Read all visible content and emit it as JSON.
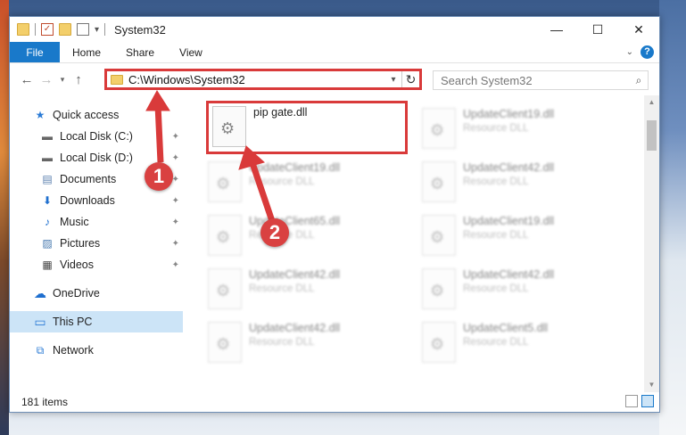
{
  "window": {
    "title": "System32",
    "minimize_glyph": "—",
    "maximize_glyph": "☐",
    "close_glyph": "✕"
  },
  "ribbon": {
    "tabs": [
      "File",
      "Home",
      "Share",
      "View"
    ],
    "help_glyph": "?",
    "expand_glyph": "⌄"
  },
  "nav": {
    "back_glyph": "←",
    "forward_glyph": "→",
    "recent_glyph": "▾",
    "up_glyph": "↑"
  },
  "address": {
    "path": "C:\\Windows\\System32",
    "dropdown_glyph": "▾",
    "refresh_glyph": "↻"
  },
  "search": {
    "placeholder": "Search System32",
    "icon_glyph": "⌕"
  },
  "sidebar": {
    "items": [
      {
        "label": "Quick access",
        "icon": "star-icon",
        "glyph": "★",
        "pinned": false
      },
      {
        "label": "Local Disk (C:)",
        "icon": "drive-icon",
        "glyph": "▬",
        "pinned": true
      },
      {
        "label": "Local Disk (D:)",
        "icon": "drive-icon",
        "glyph": "▬",
        "pinned": true
      },
      {
        "label": "Documents",
        "icon": "documents-icon",
        "glyph": "▤",
        "pinned": true
      },
      {
        "label": "Downloads",
        "icon": "download-icon",
        "glyph": "⬇",
        "pinned": true
      },
      {
        "label": "Music",
        "icon": "music-icon",
        "glyph": "♪",
        "pinned": true
      },
      {
        "label": "Pictures",
        "icon": "pictures-icon",
        "glyph": "▨",
        "pinned": true
      },
      {
        "label": "Videos",
        "icon": "videos-icon",
        "glyph": "▦",
        "pinned": true
      },
      {
        "label": "OneDrive",
        "icon": "cloud-icon",
        "glyph": "☁",
        "pinned": false
      },
      {
        "label": "This PC",
        "icon": "computer-icon",
        "glyph": "▭",
        "pinned": false
      },
      {
        "label": "Network",
        "icon": "network-icon",
        "glyph": "⧉",
        "pinned": false
      }
    ],
    "pin_glyph": "📌"
  },
  "files": [
    {
      "name": "pip gate.dll",
      "type": ""
    },
    {
      "name": "UpdateClient19.dll",
      "type": "Resource DLL"
    },
    {
      "name": "UpdateClient19.dll",
      "type": "Resource DLL"
    },
    {
      "name": "UpdateClient42.dll",
      "type": "Resource DLL"
    },
    {
      "name": "UpdateClient65.dll",
      "type": "Resource DLL"
    },
    {
      "name": "UpdateClient19.dll",
      "type": "Resource DLL"
    },
    {
      "name": "UpdateClient42.dll",
      "type": "Resource DLL"
    },
    {
      "name": "UpdateClient42.dll",
      "type": "Resource DLL"
    },
    {
      "name": "UpdateClient42.dll",
      "type": "Resource DLL"
    },
    {
      "name": "UpdateClient5.dll",
      "type": "Resource DLL"
    }
  ],
  "status": {
    "item_count": "181 items"
  },
  "annotations": {
    "callout_1": "1",
    "callout_2": "2",
    "color": "#d93a3a"
  }
}
